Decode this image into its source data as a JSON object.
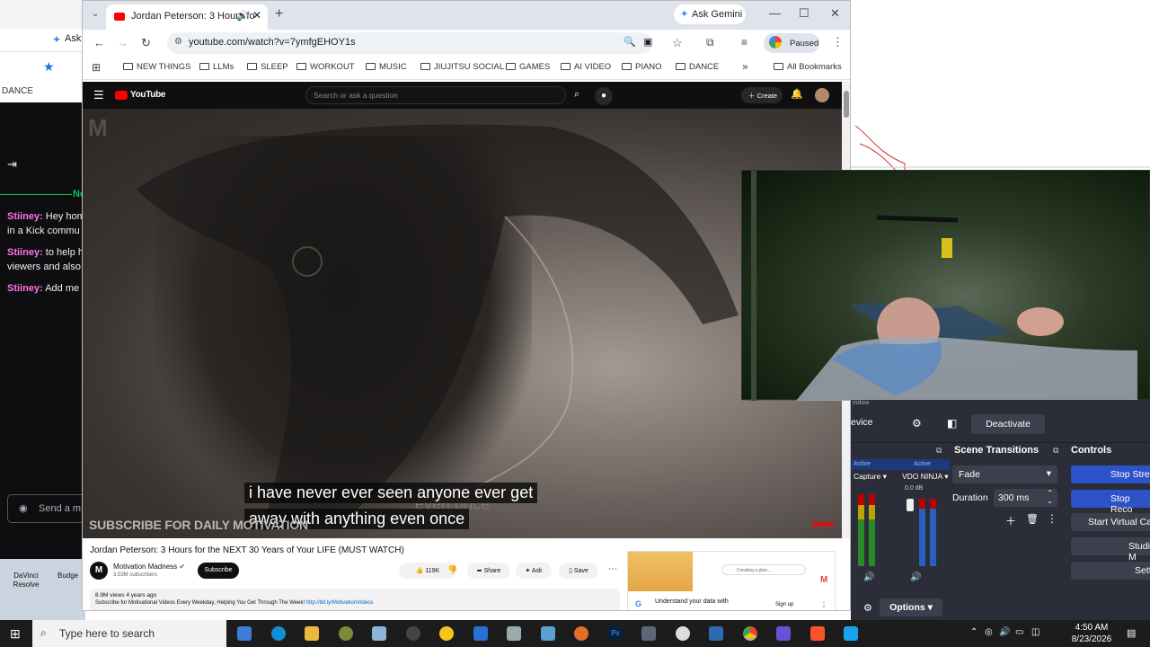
{
  "chat_window": {
    "tab_fragment": "Ask",
    "bookmark": "DANCE",
    "messages": [
      {
        "user": "Stiiney:",
        "text": "Hey hom",
        "text2": "in a Kick commu"
      },
      {
        "user": "Stiiney:",
        "text": "to help h",
        "text2": "viewers and also"
      },
      {
        "user": "Stiiney:",
        "text": "Add me"
      }
    ],
    "send_placeholder": "Send a m",
    "new_marker": "Ne",
    "desktop_icons": [
      "DaVinci Resolve",
      "Budge"
    ]
  },
  "browser": {
    "tab_title": "Jordan Peterson: 3 Hours fo",
    "ask_gemini": "Ask Gemini",
    "url": "youtube.com/watch?v=7ymfgEHOY1s",
    "profile_status": "Paused",
    "bookmarks": [
      "NEW THINGS",
      "LLMs",
      "SLEEP",
      "WORKOUT",
      "MUSIC",
      "JIUJITSU SOCIAL",
      "GAMES",
      "AI VIDEO",
      "PIANO",
      "DANCE"
    ],
    "all_bookmarks": "All Bookmarks"
  },
  "youtube": {
    "logo_text": "YouTube",
    "search_placeholder": "Search or ask a question",
    "create_label": "Create",
    "caption_line1": "i have never ever seen anyone ever get",
    "caption_line2": "away with anything even once",
    "watermark_caption": "even once",
    "subscribe_overlay": "SUBSCRIBE FOR DAILY MOTIVATION",
    "video_title": "Jordan Peterson: 3 Hours for the NEXT 30 Years of Your LIFE (MUST WATCH)",
    "channel_name": "Motivation Madness",
    "subscribers": "3.53M subscribers",
    "subscribe_button": "Subscribe",
    "likes": "119K",
    "share": "Share",
    "ask": "Ask",
    "save": "Save",
    "views_meta": "8.9M views  4 years ago",
    "description": "Subscribe for Motivational Videos Every Weekday, Helping You Get Through The Week!",
    "description_link": "http://bit.ly/MotivationVideos",
    "ad_text": "Understand your data with",
    "ad_subtext": "Creating a plan...",
    "ad_button": "Sign up"
  },
  "obs": {
    "window_fragment": "indow",
    "device_fragment": "evice",
    "deactivate": "Deactivate",
    "scene_transitions": "Scene Transitions",
    "controls": "Controls",
    "transition": "Fade",
    "duration_label": "Duration",
    "duration_value": "300 ms",
    "active_label_1": "Active",
    "active_label_2": "Active",
    "source_1": "Capture",
    "source_2": "VDO NINJA",
    "db_value": "0.0 dB",
    "options": "Options",
    "control_buttons": [
      "Stop Stre",
      "Stop Reco",
      "Start Virtual Ca",
      "Studio M",
      "Settin"
    ]
  },
  "taskbar": {
    "search_placeholder": "Type here to search",
    "time": "4:50 AM",
    "date": "8/23/2026"
  },
  "colors": {
    "youtube_red": "#ff0000",
    "obs_blue": "#2e52c8",
    "chat_name": "#ff75e6"
  }
}
